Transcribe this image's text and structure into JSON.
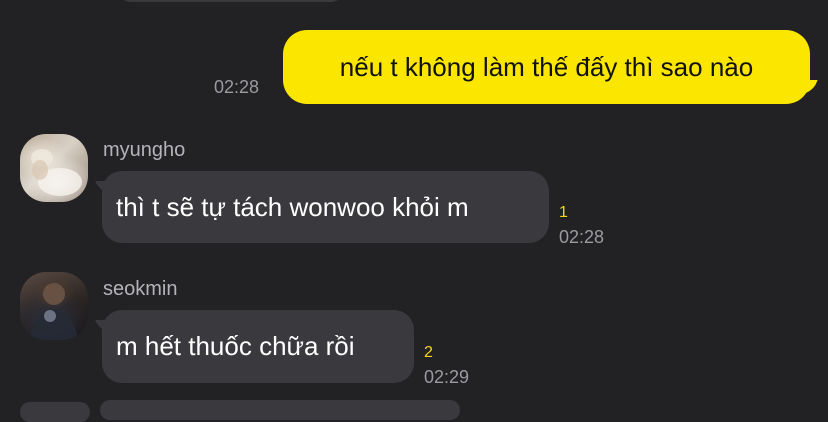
{
  "messages": [
    {
      "direction": "outgoing",
      "text": "nếu t không làm thế đấy thì sao nào",
      "time": "02:28"
    },
    {
      "direction": "incoming",
      "sender": "myungho",
      "text": "thì t sẽ tự tách wonwoo khỏi m",
      "unread_count": "1",
      "time": "02:28"
    },
    {
      "direction": "incoming",
      "sender": "seokmin",
      "text": "m hết thuốc chữa rồi",
      "unread_count": "2",
      "time": "02:29"
    }
  ],
  "colors": {
    "background": "#222124",
    "outgoing_bubble": "#fbe600",
    "incoming_bubble": "#3a393d",
    "unread_count": "#f7d617",
    "timestamp": "#9b9a9f",
    "sender_name": "#b4b3b8"
  }
}
